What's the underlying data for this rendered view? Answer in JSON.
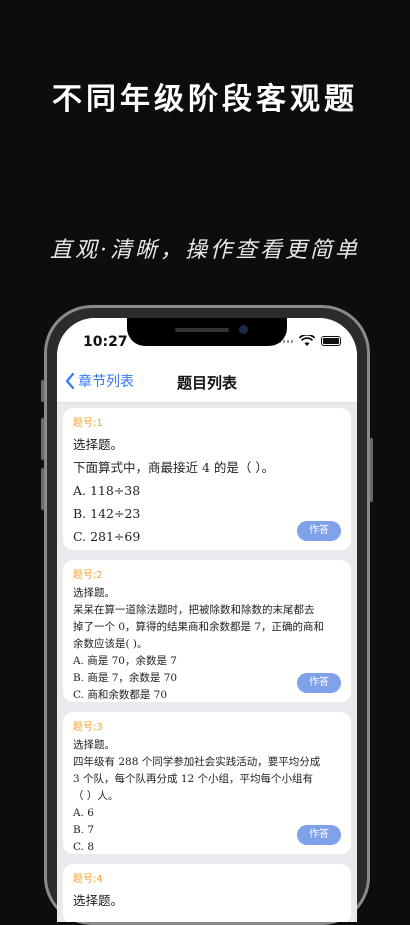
{
  "promo": {
    "title": "不同年级阶段客观题",
    "subtitle": "直观·清晰，操作查看更简单"
  },
  "status_bar": {
    "time": "10:27"
  },
  "nav": {
    "back_label": "章节列表",
    "title": "题目列表"
  },
  "questions": [
    {
      "number": "题号:1",
      "type": "选择题。",
      "stem": "下面算式中，商最接近 4 的是（    ）。",
      "options": [
        "A. 118÷38",
        "B. 142÷23",
        "C. 281÷69"
      ],
      "button": "作答"
    },
    {
      "number": "题号:2",
      "type": "选择题。",
      "stem_lines": [
        "呆呆在算一道除法题时，把被除数和除数的末尾都去",
        "掉了一个 0，算得的结果商和余数都是 7，正确的商和",
        "余数应该是(          )。"
      ],
      "options": [
        "A.  商是 70，余数是 7",
        "B.  商是 7，余数是 70",
        "C.  商和余数都是 70"
      ],
      "button": "作答"
    },
    {
      "number": "题号:3",
      "type": "选择题。",
      "stem_lines": [
        "四年级有 288 个同学参加社会实践活动，要平均分成",
        "3 个队，每个队再分成 12 个小组，平均每个小组有",
        "（                        ）人。"
      ],
      "options": [
        "A. 6",
        "B. 7",
        "C. 8"
      ],
      "button": "作答"
    },
    {
      "number": "题号:4",
      "type": "选择题。"
    }
  ]
}
